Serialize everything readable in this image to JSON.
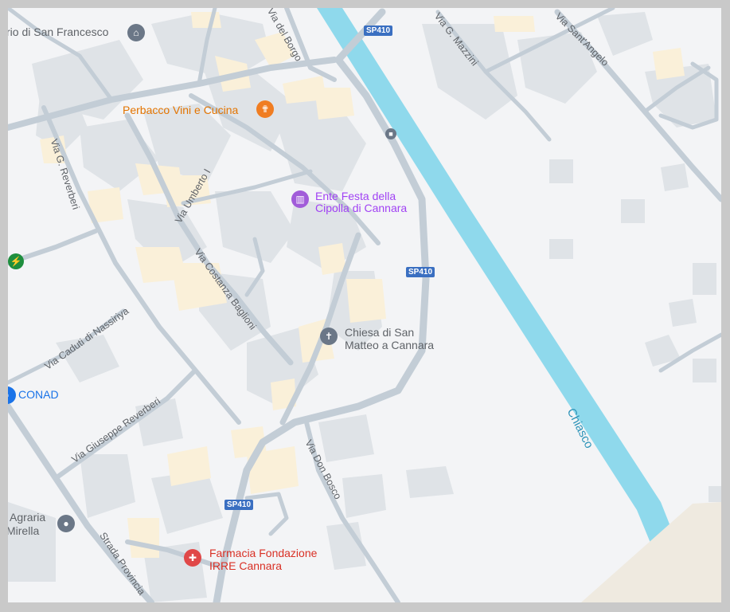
{
  "map": {
    "colors": {
      "background": "#f3f4f6",
      "river": "#8fd9ec",
      "road": "#c3cdd6",
      "building": "#dfe3e7",
      "highlight_building": "#faf0d9",
      "fuel_pin": "#1e8e3e",
      "food_pin": "#f07d22",
      "cultural_pin": "#a15cd9",
      "church_pin": "#6b7787",
      "shop_pin": "#6b7787",
      "pharmacy_pin": "#e04848"
    },
    "pois": {
      "san_francesco": {
        "text": "rio di San Francesco",
        "icon": "museum-icon",
        "color": "#5f6368"
      },
      "perbacco": {
        "text": "Perbacco Vini e Cucina",
        "icon": "restaurant-icon",
        "color": "#e37400"
      },
      "ente_festa": {
        "line1": "Ente Festa della",
        "line2": "Cipolla di Cannara",
        "icon": "landmark-icon",
        "color": "#a142f4"
      },
      "chiesa": {
        "line1": "Chiesa di San",
        "line2": "Matteo a Cannara",
        "icon": "church-icon",
        "color": "#5f6368"
      },
      "conad": {
        "text": "CONAD",
        "icon": "shopping-icon",
        "color": "#1a73e8"
      },
      "agraria": {
        "line1": "Agraria",
        "line2": "Mirella",
        "icon": "shop-icon",
        "color": "#5f6368"
      },
      "farmacia": {
        "line1": "Farmacia Fondazione",
        "line2": "IRRE Cannara",
        "icon": "pharmacy-icon",
        "color": "#d93025"
      },
      "charging": {
        "icon": "ev-charging-icon"
      }
    },
    "streets": {
      "via_del_borgo": "Via del Borgo",
      "via_g_mazzini": "Via G. Mazzini",
      "via_sant_angelo": "Via Sant'Angelo",
      "via_g_reverberi": "Via G. Reverberi",
      "via_umberto": "Via Umberto I",
      "via_costanza_baglioni": "Via Costanza Baglioni",
      "via_caduti_di_nassiriya": "Via Caduti di Nassiriya",
      "via_giuseppe_reverberi": "Via Giuseppe Reverberi",
      "via_don_bosco": "Via Don Bosco",
      "strada_provinciale": "Strada Provincia"
    },
    "river_name": "Chiasco",
    "road_shields": [
      "SP410",
      "SP410",
      "SP410"
    ],
    "transit_icon": "bus-stop-icon"
  }
}
